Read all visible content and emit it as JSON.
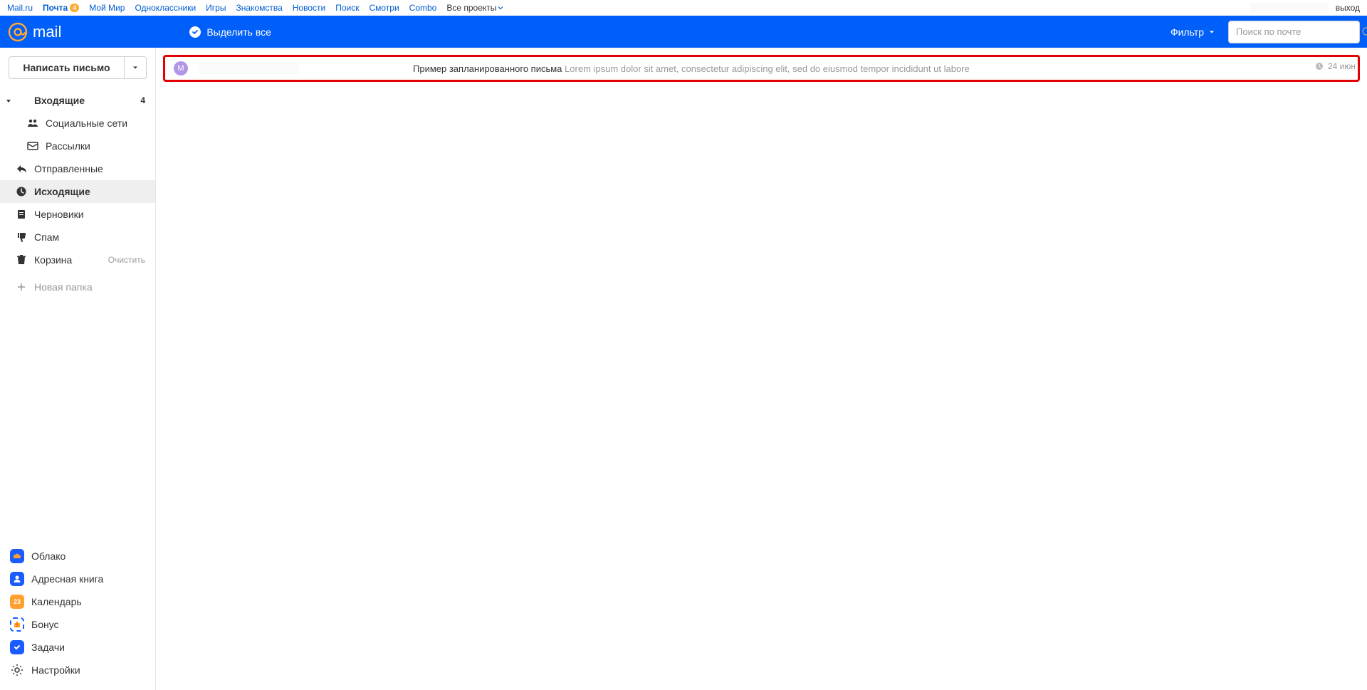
{
  "topnav": {
    "items": [
      "Mail.ru",
      "Почта",
      "Мой Мир",
      "Одноклассники",
      "Игры",
      "Знакомства",
      "Новости",
      "Поиск",
      "Смотри",
      "Combo",
      "Все проекты"
    ],
    "badge": "4",
    "logout": "выход"
  },
  "header": {
    "logo_text": "mail",
    "select_all": "Выделить все",
    "filter": "Фильтр",
    "search_placeholder": "Поиск по почте"
  },
  "sidebar": {
    "compose": "Написать письмо",
    "folders": {
      "inbox": {
        "label": "Входящие",
        "count": "4"
      },
      "social": {
        "label": "Социальные сети"
      },
      "newsletters": {
        "label": "Рассылки"
      },
      "sent": {
        "label": "Отправленные"
      },
      "outbox": {
        "label": "Исходящие"
      },
      "drafts": {
        "label": "Черновики"
      },
      "spam": {
        "label": "Спам"
      },
      "trash": {
        "label": "Корзина",
        "action": "Очистить"
      }
    },
    "new_folder": "Новая папка",
    "bottom": {
      "cloud": "Облако",
      "contacts": "Адресная книга",
      "calendar": "Календарь",
      "calendar_day": "23",
      "bonus": "Бонус",
      "tasks": "Задачи",
      "settings": "Настройки"
    }
  },
  "mail_row": {
    "avatar_letter": "М",
    "subject": "Пример запланированного письма",
    "preview": "Lorem ipsum dolor sit amet, consectetur adipiscing elit, sed do eiusmod tempor incididunt ut labore",
    "date": "24 июн"
  }
}
